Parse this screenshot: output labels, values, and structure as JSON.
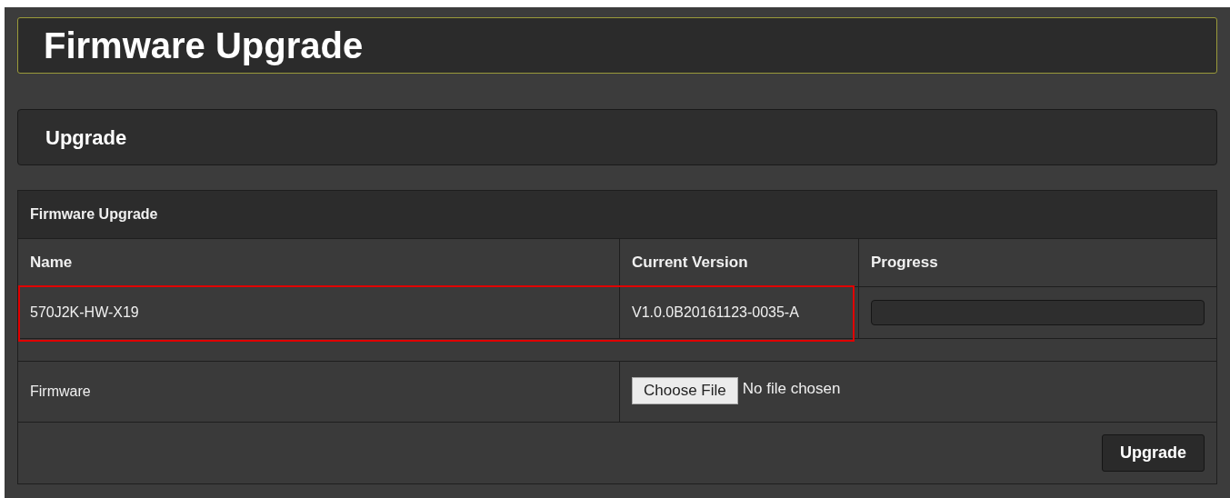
{
  "page_title": "Firmware Upgrade",
  "section_title": "Upgrade",
  "table": {
    "caption": "Firmware Upgrade",
    "columns": [
      "Name",
      "Current Version",
      "Progress"
    ],
    "row": {
      "name": "570J2K-HW-X19",
      "version": "V1.0.0B20161123-0035-A",
      "level": 0,
      "highlighted": true
    },
    "firmware": {
      "label": "Firmware",
      "button": "Choose File",
      "status": "No file chosen"
    },
    "submit": "Upgrade"
  }
}
